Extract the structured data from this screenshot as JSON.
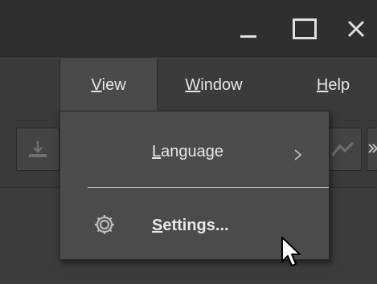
{
  "colors": {
    "background": "#3a3a3a",
    "titlebar": "#2f2f2f",
    "menu_open": "#4a4a4a",
    "dropdown": "#4b4b4b",
    "text": "#e6e6e6",
    "separator": "#cfcfcf"
  },
  "window_controls": {
    "minimize_icon": "minimize-icon",
    "maximize_icon": "maximize-icon",
    "close_icon": "close-icon"
  },
  "menubar": {
    "items": [
      {
        "mnemonic": "V",
        "rest": "iew",
        "open": true
      },
      {
        "mnemonic": "W",
        "rest": "indow",
        "open": false
      },
      {
        "mnemonic": "H",
        "rest": "elp",
        "open": false
      }
    ]
  },
  "toolbar": {
    "icons": [
      "download-icon",
      "share-icon",
      "chevron-double-right-icon"
    ]
  },
  "dropdown": {
    "items": [
      {
        "mnemonic": "L",
        "rest": "anguage",
        "has_submenu": true,
        "icon": ""
      },
      {
        "mnemonic": "S",
        "rest": "ettings...",
        "has_submenu": false,
        "icon": "gear-icon"
      }
    ]
  },
  "cursor_icon": "mouse-pointer-icon"
}
